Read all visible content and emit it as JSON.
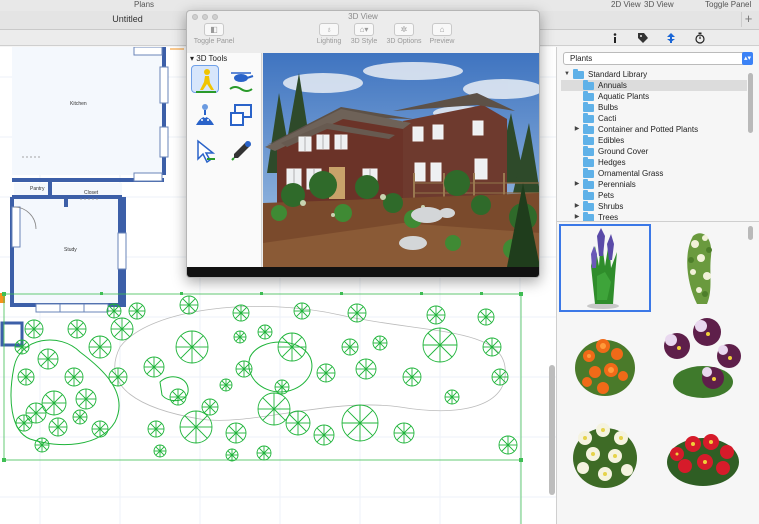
{
  "topbar": {
    "plans_label": "Plans",
    "view_2d": "2D View",
    "view_3d": "3D View",
    "toggle_panel": "Toggle Panel"
  },
  "document": {
    "title": "Untitled"
  },
  "toolbar": {
    "icons": [
      "info-icon",
      "tag-icon",
      "plant-icon",
      "timer-icon"
    ]
  },
  "floorplan": {
    "rooms": [
      "Kitchen",
      "Pantry",
      "Closet",
      "Study"
    ]
  },
  "window3d": {
    "title": "3D View",
    "toolbar": [
      {
        "label": "Toggle Panel",
        "icon": "sidebar-icon"
      },
      {
        "label": "Lighting",
        "icon": "bulb-icon"
      },
      {
        "label": "3D Style",
        "icon": "style-icon"
      },
      {
        "label": "3D Options",
        "icon": "gear-icon"
      },
      {
        "label": "Preview",
        "icon": "house-icon"
      }
    ],
    "tools_header": "3D Tools"
  },
  "library": {
    "category": "Plants",
    "tree": [
      {
        "label": "Standard Library",
        "level": 0,
        "disclosure": "open"
      },
      {
        "label": "Annuals",
        "level": 1,
        "disclosure": "none",
        "selected": true
      },
      {
        "label": "Aquatic Plants",
        "level": 1,
        "disclosure": "none"
      },
      {
        "label": "Bulbs",
        "level": 1,
        "disclosure": "none"
      },
      {
        "label": "Cacti",
        "level": 1,
        "disclosure": "none"
      },
      {
        "label": "Container and Potted Plants",
        "level": 1,
        "disclosure": "closed"
      },
      {
        "label": "Edibles",
        "level": 1,
        "disclosure": "none"
      },
      {
        "label": "Ground Cover",
        "level": 1,
        "disclosure": "none"
      },
      {
        "label": "Hedges",
        "level": 1,
        "disclosure": "none"
      },
      {
        "label": "Ornamental Grass",
        "level": 1,
        "disclosure": "none"
      },
      {
        "label": "Perennials",
        "level": 1,
        "disclosure": "closed"
      },
      {
        "label": "Pets",
        "level": 1,
        "disclosure": "none"
      },
      {
        "label": "Shrubs",
        "level": 1,
        "disclosure": "closed"
      },
      {
        "label": "Trees",
        "level": 1,
        "disclosure": "closed"
      }
    ],
    "thumbnails": [
      {
        "name": "purple-spike-plant",
        "selected": true
      },
      {
        "name": "white-flowering-shrub",
        "selected": false
      },
      {
        "name": "orange-flower-bush",
        "selected": false
      },
      {
        "name": "purple-pansies",
        "selected": false
      },
      {
        "name": "white-flower-bush",
        "selected": false
      },
      {
        "name": "red-flower-bush",
        "selected": false
      }
    ]
  },
  "colors": {
    "wall": "#3c5fa8",
    "plant_symbol": "#1fb43a",
    "accent": "#3b78e7",
    "folder": "#5fb1e8"
  }
}
